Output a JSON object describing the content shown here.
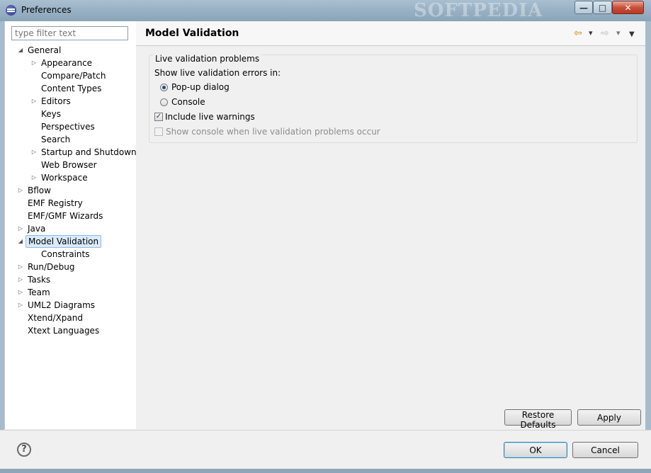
{
  "window": {
    "title": "Preferences",
    "watermark": "SOFTPEDIA",
    "min_glyph": "—",
    "max_glyph": "□",
    "close_glyph": "✕"
  },
  "filter": {
    "placeholder": "type filter text",
    "value": ""
  },
  "tree": [
    {
      "label": "General",
      "arrow": "◢"
    },
    {
      "label": "Appearance",
      "arrow": "▷"
    },
    {
      "label": "Compare/Patch",
      "arrow": ""
    },
    {
      "label": "Content Types",
      "arrow": ""
    },
    {
      "label": "Editors",
      "arrow": "▷"
    },
    {
      "label": "Keys",
      "arrow": ""
    },
    {
      "label": "Perspectives",
      "arrow": ""
    },
    {
      "label": "Search",
      "arrow": ""
    },
    {
      "label": "Startup and Shutdown",
      "arrow": "▷"
    },
    {
      "label": "Web Browser",
      "arrow": ""
    },
    {
      "label": "Workspace",
      "arrow": "▷"
    },
    {
      "label": "Bflow",
      "arrow": "▷"
    },
    {
      "label": "EMF Registry",
      "arrow": ""
    },
    {
      "label": "EMF/GMF Wizards",
      "arrow": ""
    },
    {
      "label": "Java",
      "arrow": "▷"
    },
    {
      "label": "Model Validation",
      "arrow": "◢",
      "selected": true
    },
    {
      "label": "Constraints",
      "arrow": ""
    },
    {
      "label": "Run/Debug",
      "arrow": "▷"
    },
    {
      "label": "Tasks",
      "arrow": "▷"
    },
    {
      "label": "Team",
      "arrow": "▷"
    },
    {
      "label": "UML2 Diagrams",
      "arrow": "▷"
    },
    {
      "label": "Xtend/Xpand",
      "arrow": ""
    },
    {
      "label": "Xtext Languages",
      "arrow": ""
    }
  ],
  "page": {
    "title": "Model Validation",
    "nav_back": "⇦",
    "nav_forward": "⇨",
    "dropdown": "▾",
    "menu": "▼"
  },
  "group": {
    "title": "Live validation problems",
    "show_label": "Show live validation errors in:",
    "radio_popup": "Pop-up dialog",
    "radio_popup_selected": true,
    "radio_console": "Console",
    "radio_console_selected": false,
    "check_warnings": "Include live warnings",
    "check_warnings_checked": true,
    "check_console": "Show console when live validation problems occur",
    "check_console_checked": false,
    "check_mark": "✓"
  },
  "buttons": {
    "restore": "Restore Defaults",
    "apply": "Apply",
    "ok": "OK",
    "cancel": "Cancel",
    "help": "?"
  },
  "colors": {
    "selection_bg": "#dbeaf9",
    "selection_border": "#8cbbe9",
    "title_bar": "#9bb3c6"
  }
}
